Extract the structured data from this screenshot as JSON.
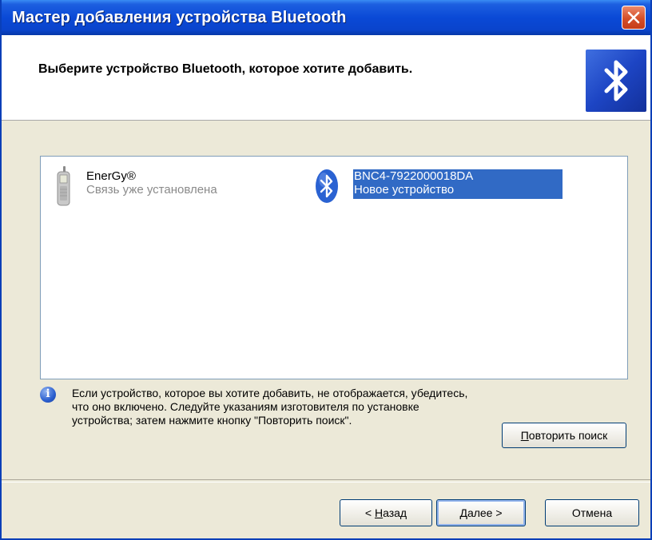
{
  "window": {
    "title": "Мастер добавления устройства Bluetooth"
  },
  "header": {
    "title": "Выберите устройство Bluetooth, которое хотите добавить.",
    "logo_icon": "bluetooth-logo-icon"
  },
  "devices": [
    {
      "name": "EnerGy®",
      "status": "Связь уже установлена",
      "icon": "mobile-phone-icon",
      "selected": false
    },
    {
      "name": "BNC4-7922000018DA",
      "status": "Новое устройство",
      "icon": "bluetooth-device-icon",
      "selected": true
    }
  ],
  "info": {
    "icon": "info-icon",
    "text": "Если устройство, которое вы хотите добавить, не отображается, убедитесь, что оно включено. Следуйте указаниям изготовителя по установке устройства; затем нажмите кнопку \"Повторить поиск\"."
  },
  "buttons": {
    "rescan": {
      "mnemonic": "П",
      "rest": "овторить поиск"
    },
    "back": {
      "prefix": "< ",
      "mnemonic": "Н",
      "rest": "азад"
    },
    "next": {
      "mnemonic": "Д",
      "rest": "алее >"
    },
    "cancel": "Отмена"
  },
  "colors": {
    "titlebar": "#0a49d6",
    "selection": "#316ac5",
    "close_button": "#d44e28",
    "dialog_background": "#ece9d8"
  }
}
